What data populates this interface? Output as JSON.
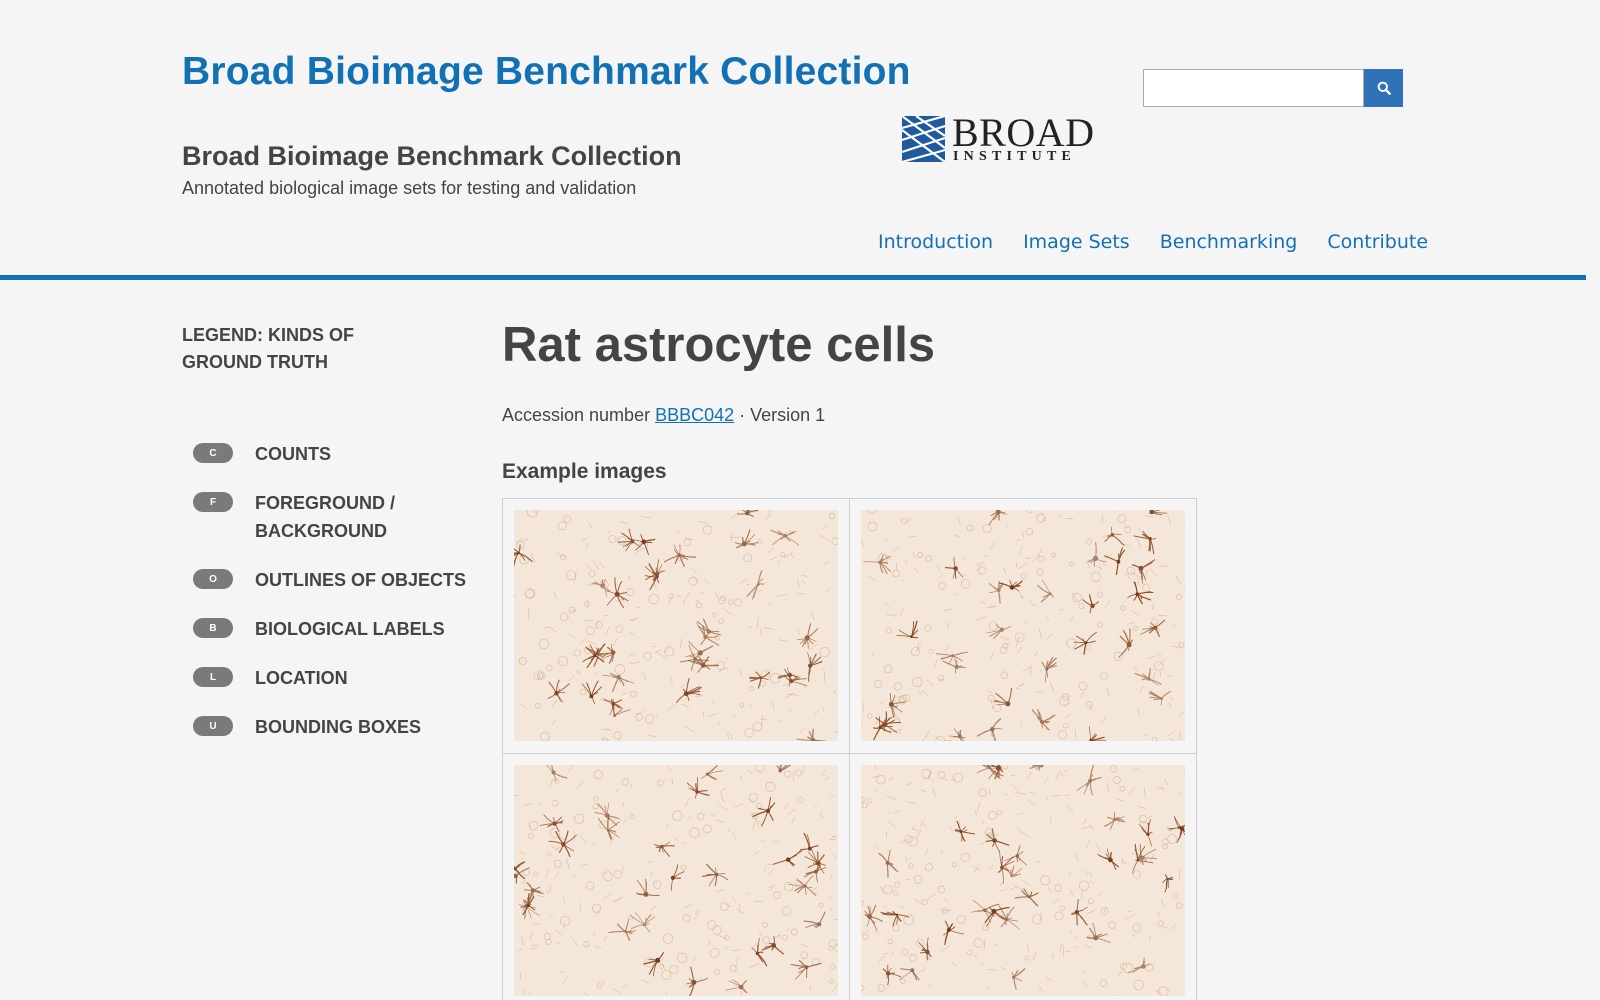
{
  "header": {
    "site_title": "Broad Bioimage Benchmark Collection",
    "subtitle": "Broad Bioimage Benchmark Collection",
    "tagline": "Annotated biological image sets for testing and validation",
    "search_placeholder": "",
    "logo": {
      "name": "BROAD",
      "sub": "INSTITUTE"
    }
  },
  "nav": {
    "items": [
      {
        "label": "Introduction"
      },
      {
        "label": "Image Sets"
      },
      {
        "label": "Benchmarking"
      },
      {
        "label": "Contribute"
      }
    ]
  },
  "legend": {
    "title": "LEGEND: KINDS OF GROUND TRUTH",
    "items": [
      {
        "badge": "C",
        "label": "COUNTS"
      },
      {
        "badge": "F",
        "label": "FOREGROUND / BACKGROUND"
      },
      {
        "badge": "O",
        "label": "OUTLINES OF OBJECTS"
      },
      {
        "badge": "B",
        "label": "BIOLOGICAL LABELS"
      },
      {
        "badge": "L",
        "label": "LOCATION"
      },
      {
        "badge": "U",
        "label": "BOUNDING BOXES"
      }
    ]
  },
  "main": {
    "title": "Rat astrocyte cells",
    "accession_prefix": "Accession number ",
    "accession_number": "BBBC042",
    "version_text": " · Version 1",
    "example_heading": "Example images"
  },
  "colors": {
    "brand_blue": "#1271b5",
    "search_button": "#2f72b5",
    "badge_gray": "#7a7a7a",
    "tissue_base": "#f4e6d8",
    "tissue_stain": "#8a4a22"
  }
}
